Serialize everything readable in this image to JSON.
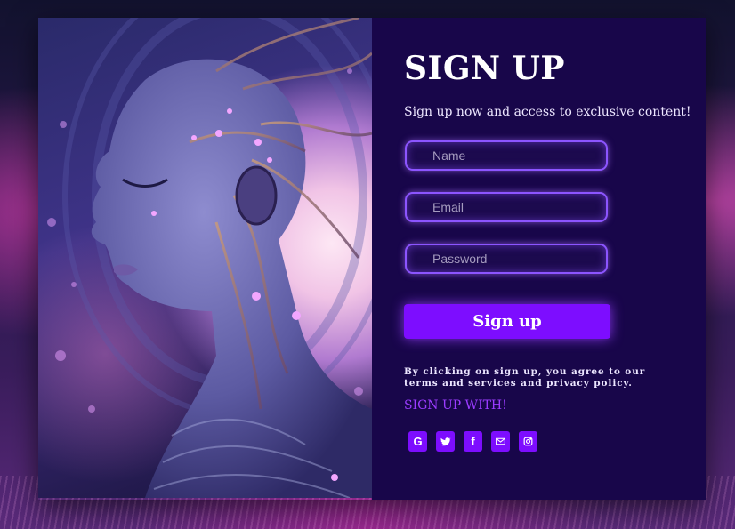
{
  "background": {
    "accent": "#7d0dff",
    "panel": "#18064a"
  },
  "hero": {
    "image": "ai-woman-illustration"
  },
  "form": {
    "title": "SIGN UP",
    "subtitle": "Sign up now and access to exclusive content!",
    "name_placeholder": "Name",
    "email_placeholder": "Email",
    "password_placeholder": "Password",
    "submit_label": "Sign up",
    "terms": "By clicking on sign up, you agree to our terms and services and privacy policy.",
    "social_heading": "SIGN UP WITH!"
  },
  "socials": [
    {
      "icon": "google-icon"
    },
    {
      "icon": "twitter-icon"
    },
    {
      "icon": "facebook-icon"
    },
    {
      "icon": "envelope-icon"
    },
    {
      "icon": "instagram-icon"
    }
  ]
}
